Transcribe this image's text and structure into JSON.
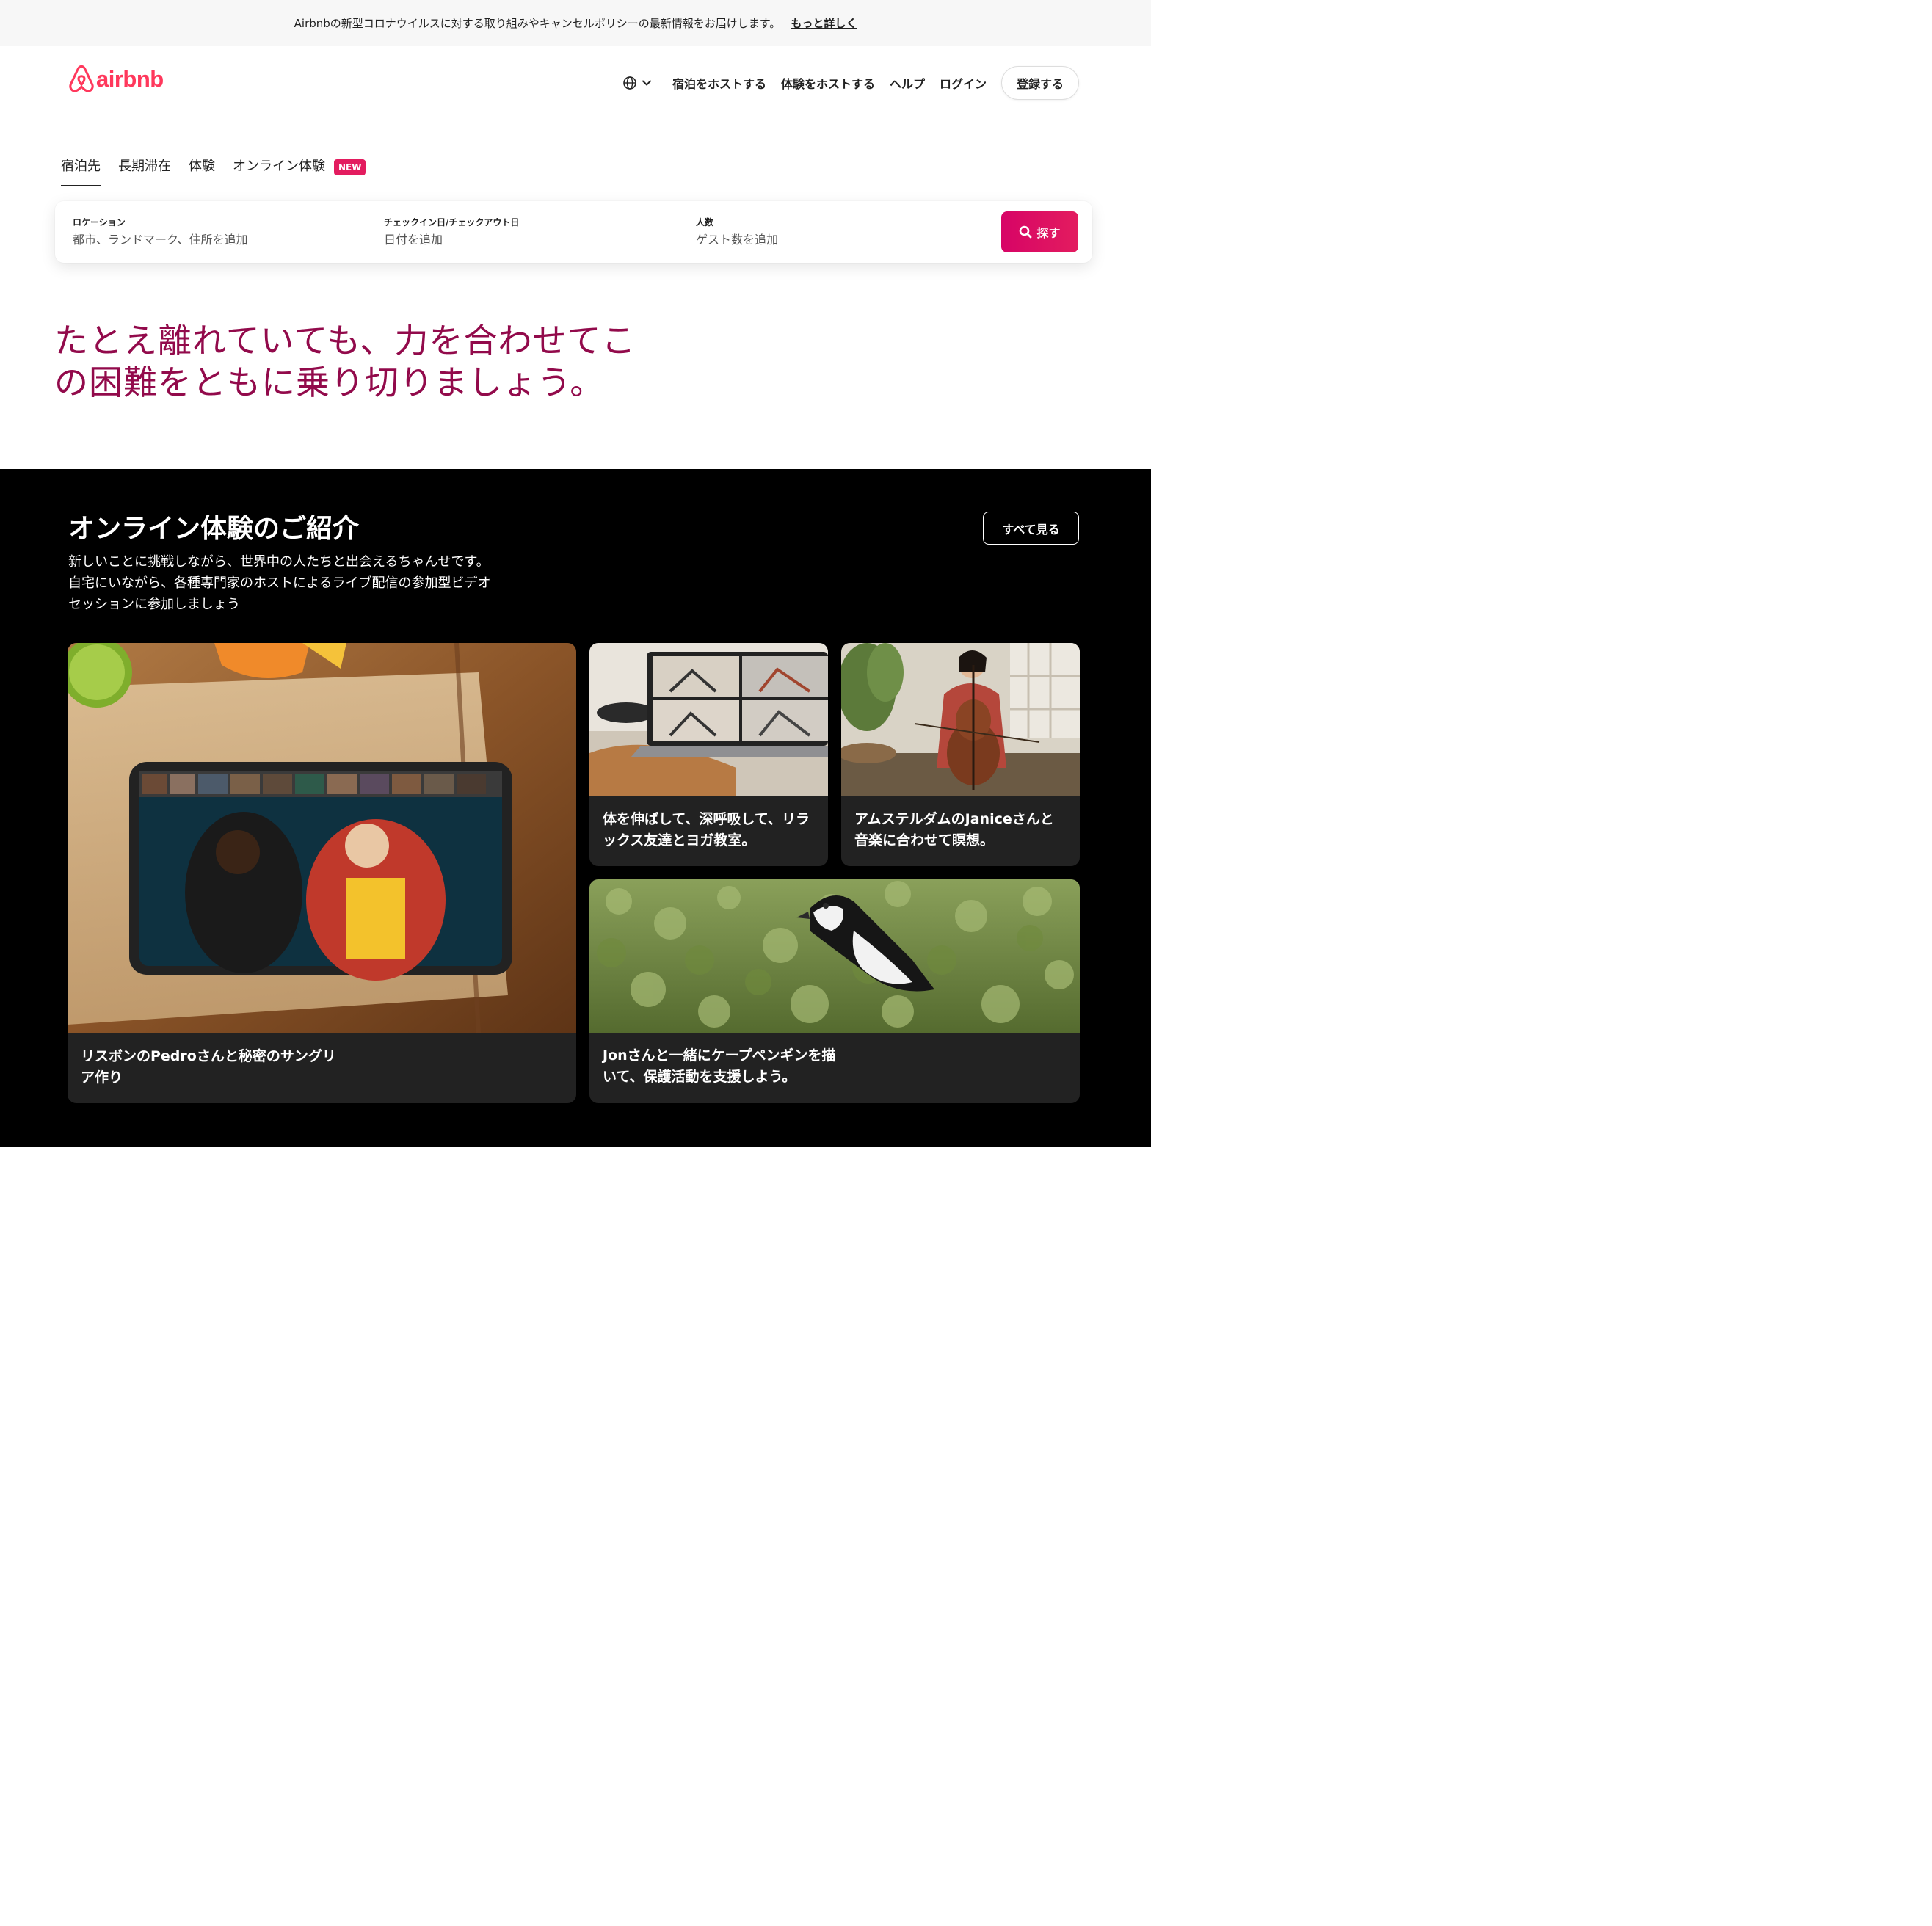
{
  "banner": {
    "text": "Airbnbの新型コロナウイルスに対する取り組みやキャンセルポリシーの最新情報をお届けします。",
    "link": "もっと詳しく"
  },
  "header": {
    "logo_text": "airbnb",
    "nav": {
      "host_stays": "宿泊をホストする",
      "host_experiences": "体験をホストする",
      "help": "ヘルプ",
      "login": "ログイン",
      "signup": "登録する"
    }
  },
  "tabs": [
    {
      "label": "宿泊先",
      "active": true
    },
    {
      "label": "長期滞在",
      "active": false
    },
    {
      "label": "体験",
      "active": false
    },
    {
      "label": "オンライン体験",
      "active": false,
      "badge": "NEW"
    }
  ],
  "search": {
    "location": {
      "label": "ロケーション",
      "placeholder": "都市、ランドマーク、住所を追加"
    },
    "dates": {
      "label": "チェックイン日/チェックアウト日",
      "placeholder": "日付を追加"
    },
    "guests": {
      "label": "人数",
      "placeholder": "ゲスト数を追加"
    },
    "button": "探す"
  },
  "hero": {
    "line1": "たとえ離れていても、力を合わせてこ",
    "line2": "の困難をともに乗り切りましょう。"
  },
  "online": {
    "title": "オンライン体験のご紹介",
    "desc_line1": "新しいことに挑戦しながら、世界中の人たちと出会えるちゃんせです。",
    "desc_line2": "自宅にいながら、各種専門家のホストによるライブ配信の参加型ビデオ",
    "desc_line3": "セッションに参加しましょう",
    "see_all": "すべて見る",
    "cards": [
      {
        "caption": "リスボンのPedroさんと秘密のサングリア作り"
      },
      {
        "caption": "体を伸ばして、深呼吸して、リラックス友達とヨガ教室。"
      },
      {
        "caption": "アムステルダムのJaniceさんと音楽に合わせて瞑想。"
      },
      {
        "caption": "Jonさんと一緒にケープペンギンを描いて、保護活動を支援しよう。"
      }
    ]
  },
  "colors": {
    "brand": "#ff385c",
    "search_button": "#e31c5f",
    "hero_text": "#920a4b",
    "dark_section": "#000000"
  }
}
